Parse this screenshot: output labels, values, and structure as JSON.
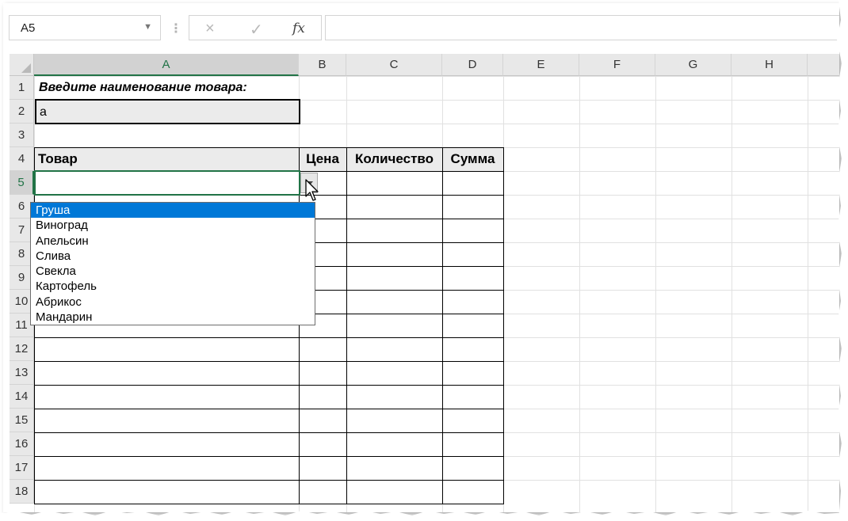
{
  "formula_bar": {
    "name_box": "A5",
    "cancel_icon": "×",
    "enter_icon": "✓",
    "fx_label": "fx",
    "formula_value": ""
  },
  "columns": [
    "A",
    "B",
    "C",
    "D",
    "E",
    "F",
    "G",
    "H"
  ],
  "rows": [
    "1",
    "2",
    "3",
    "4",
    "5",
    "6",
    "7",
    "8",
    "9",
    "10",
    "11",
    "12",
    "13",
    "14",
    "15",
    "16",
    "17",
    "18"
  ],
  "cells": {
    "A1": "Введите наименование товара:",
    "A2": "а",
    "A4": "Товар",
    "B4": "Цена",
    "C4": "Количество",
    "D4": "Сумма"
  },
  "active_cell": "A5",
  "dropdown": {
    "items": [
      "Груша",
      "Виноград",
      "Апельсин",
      "Слива",
      "Свекла",
      "Картофель",
      "Абрикос",
      "Мандарин"
    ],
    "selected_index": 0
  },
  "colors": {
    "accent": "#217346",
    "selection": "#0078d7",
    "input_fill": "#ebebeb"
  },
  "icons": [
    "chevron-down-icon",
    "cancel-icon",
    "enter-icon",
    "fx-icon",
    "dropdown-arrow-icon",
    "mouse-cursor-icon"
  ]
}
